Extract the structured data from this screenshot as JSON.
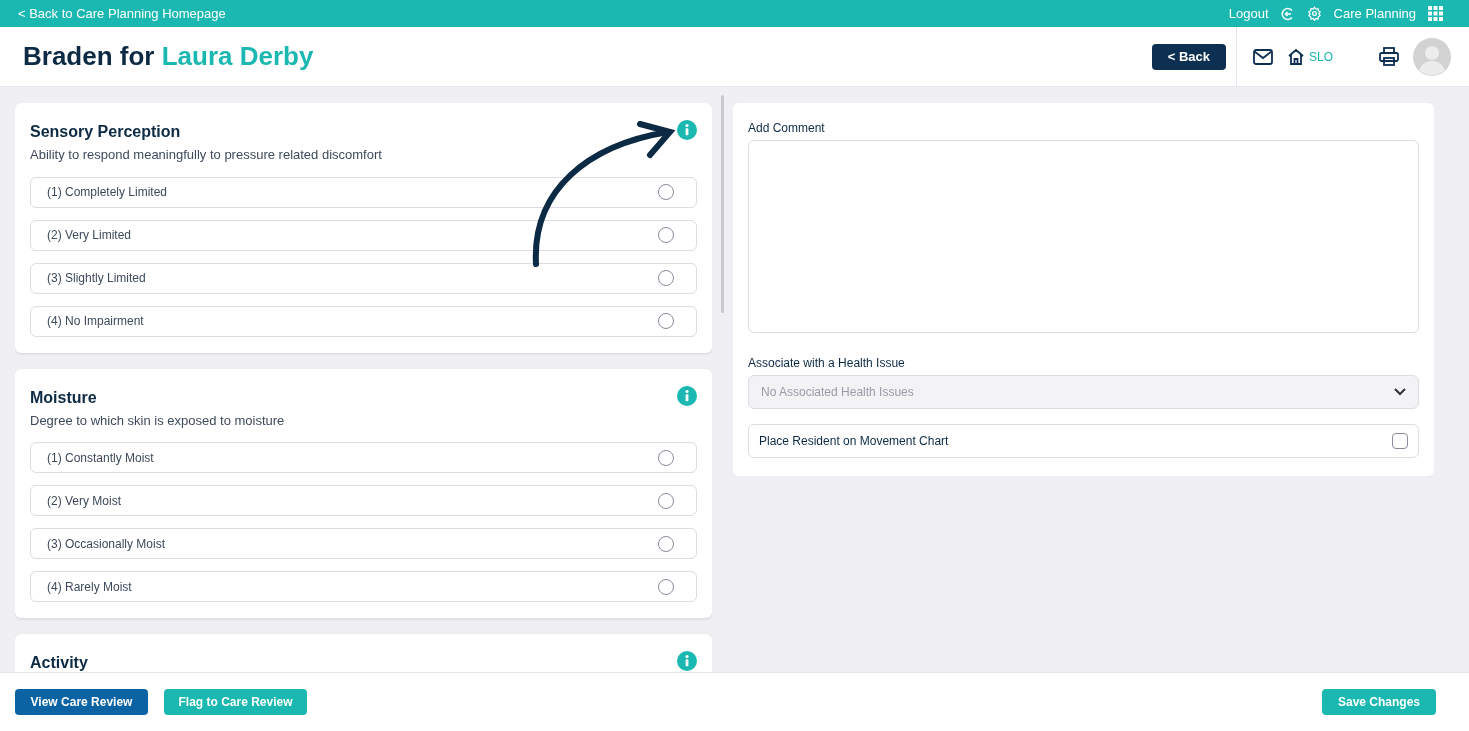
{
  "top_bar": {
    "back_link": "< Back to Care Planning Homepage",
    "logout": "Logout",
    "app_name": "Care Planning"
  },
  "header": {
    "title_prefix": "Braden for",
    "resident_name": "Laura Derby",
    "back_button": "< Back",
    "home_label": "SLO"
  },
  "sections": [
    {
      "title": "Sensory Perception",
      "description": "Ability to respond meaningfully to pressure related discomfort",
      "options": [
        {
          "label": "(1) Completely Limited",
          "selected": false
        },
        {
          "label": "(2) Very Limited",
          "selected": false
        },
        {
          "label": "(3) Slightly Limited",
          "selected": false
        },
        {
          "label": "(4) No Impairment",
          "selected": false
        }
      ]
    },
    {
      "title": "Moisture",
      "description": "Degree to which skin is exposed to moisture",
      "options": [
        {
          "label": "(1) Constantly Moist",
          "selected": false
        },
        {
          "label": "(2) Very Moist",
          "selected": false
        },
        {
          "label": "(3) Occasionally Moist",
          "selected": false
        },
        {
          "label": "(4) Rarely Moist",
          "selected": false
        }
      ]
    },
    {
      "title": "Activity"
    }
  ],
  "comment_panel": {
    "comment_label": "Add Comment",
    "health_issue_label": "Associate with a Health Issue",
    "health_issue_value": "No Associated Health Issues",
    "movement_chart": {
      "label": "Place Resident on Movement Chart",
      "checked": false
    }
  },
  "footer": {
    "view_button": "View Care Review",
    "flag_button": "Flag to Care Review",
    "save_button": "Save Changes"
  }
}
